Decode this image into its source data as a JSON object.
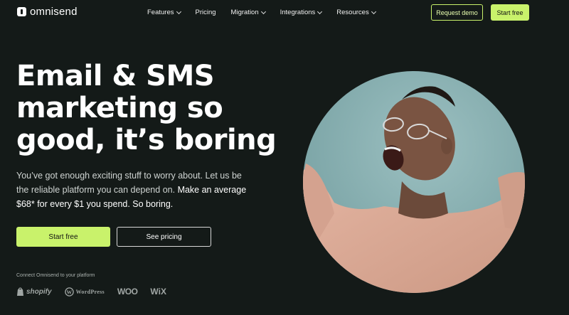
{
  "brand": {
    "name": "omnisend"
  },
  "nav": {
    "items": [
      {
        "label": "Features",
        "has_dropdown": true
      },
      {
        "label": "Pricing",
        "has_dropdown": false
      },
      {
        "label": "Migration",
        "has_dropdown": true
      },
      {
        "label": "Integrations",
        "has_dropdown": true
      },
      {
        "label": "Resources",
        "has_dropdown": true
      }
    ],
    "request_demo": "Request demo",
    "start_free": "Start free"
  },
  "hero": {
    "headline_lines": [
      "Email & SMS",
      "marketing so",
      "good, it’s boring"
    ],
    "subtext_part1": "You’ve got enough exciting stuff to worry about. Let us be the reliable platform you can depend on.",
    "subtext_part2": "Make an average $68* for every $1 you spend. So boring.",
    "primary_cta": "Start free",
    "secondary_cta": "See pricing",
    "connect_label": "Connect Omnisend to your platform",
    "platforms": [
      "shopify",
      "WordPress",
      "WOO",
      "WiX"
    ]
  },
  "colors": {
    "background": "#141a18",
    "accent": "#c9f26b",
    "image_bg": "#86aeb0",
    "sweater": "#d9a794"
  }
}
